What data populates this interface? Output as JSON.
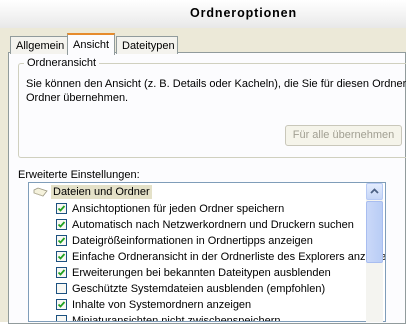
{
  "window": {
    "title": "Ordneroptionen"
  },
  "tabs": [
    {
      "label": "Allgemein",
      "active": false
    },
    {
      "label": "Ansicht",
      "active": true
    },
    {
      "label": "Dateitypen",
      "active": false
    }
  ],
  "folder_view": {
    "group_title": "Ordneransicht",
    "description": "Sie können den Ansicht (z. B. Details oder Kacheln), die Sie für diesen Ordner w Ordner übernehmen.",
    "description_line1": "Sie können den Ansicht (z. B. Details oder Kacheln), die Sie für diesen Ordner w",
    "description_line2": "Ordner übernehmen.",
    "apply_all_button": "Für alle übernehmen",
    "apply_all_enabled": false
  },
  "advanced": {
    "label": "Erweiterte Einstellungen:",
    "category": "Dateien und Ordner",
    "items": [
      {
        "label": "Ansichtoptionen für jeden Ordner speichern",
        "checked": true
      },
      {
        "label": "Automatisch nach Netzwerkordnern und Druckern suchen",
        "checked": true
      },
      {
        "label": "Dateigrößeinformationen in Ordnertipps anzeigen",
        "checked": true
      },
      {
        "label": "Einfache Ordneransicht in der Ordnerliste des Explorers anzeige",
        "checked": true
      },
      {
        "label": "Erweiterungen bei bekannten Dateitypen ausblenden",
        "checked": true
      },
      {
        "label": "Geschützte Systemdateien ausblenden (empfohlen)",
        "checked": false
      },
      {
        "label": "Inhalte von Systemordnern anzeigen",
        "checked": true
      },
      {
        "label": "Miniaturansichten nicht zwischenspeichern",
        "checked": false
      }
    ]
  },
  "colors": {
    "dialog_bg": "#ece9d8",
    "active_tab_accent": "#e68b2c",
    "checkmark": "#21a121",
    "checkbox_border": "#1c5180"
  }
}
